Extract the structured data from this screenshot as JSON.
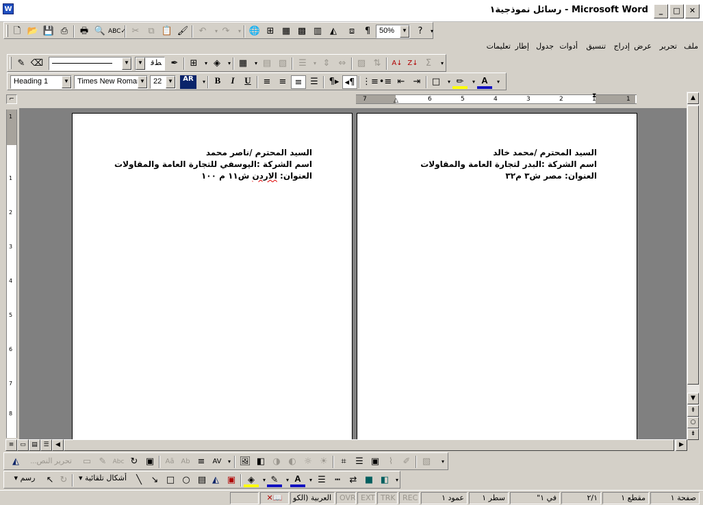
{
  "window": {
    "title": "رسائل نموذجية١ - Microsoft Word",
    "app_icon": "W",
    "buttons": [
      "_",
      "□",
      "✕"
    ]
  },
  "menu": {
    "items": [
      "ملف",
      "تحرير",
      "عرض",
      "إدراج",
      "تنسيق",
      "أدوات",
      "جدول",
      "إطار",
      "تعليمات"
    ]
  },
  "standard_toolbar": {
    "zoom": "50%"
  },
  "drawing_tools_toolbar": {
    "line_style": "",
    "direction_label": "ﻂﻗ"
  },
  "formatting_toolbar": {
    "style": "Heading 1",
    "font": "Times New Roman",
    "size": "22",
    "language_button": "AR",
    "bold": "B",
    "italic": "I",
    "underline": "U"
  },
  "ruler": {
    "h_numbers": [
      "7",
      "6",
      "5",
      "4",
      "3",
      "2",
      "1",
      "1"
    ],
    "v_numbers": [
      "1",
      "1",
      "2",
      "3",
      "4",
      "5",
      "6",
      "7",
      "8"
    ]
  },
  "pages": [
    {
      "lines": [
        {
          "text": "السيد المحترم /محمد خالد"
        },
        {
          "text": "اسم الشركة :البدر لتجارة العامة والمقاولات"
        },
        {
          "text": "العنوان: مصر ش٣ م٣٢"
        }
      ]
    },
    {
      "lines": [
        {
          "text": "السيد المحترم /ناصر محمد"
        },
        {
          "text": "اسم الشركة :اليوسفي للتجارة العامة والمقاولات"
        },
        {
          "text_before": "العنوان: ",
          "text_squiggle": "الاردن",
          "text_after": " ش١١ م ١٠٠"
        }
      ]
    }
  ],
  "reviewing_toolbar": {
    "edit_text": "تحرير النص..."
  },
  "drawing_toolbar": {
    "draw_label": "رسم",
    "autoshapes_label": "أشكال تلقائية"
  },
  "status_bar": {
    "page": "صفحة ١",
    "section": "مقطع ١",
    "page_of": "٢/١",
    "at": "في ١\"",
    "line": "سطر ١",
    "column": "عمود ١",
    "rec": "REC",
    "trk": "TRK",
    "ext": "EXT",
    "ovr": "OVR",
    "language": "العربية (الكو"
  },
  "colors": {
    "highlight": "#ffff00",
    "font_color": "#1010c0",
    "fill": "#ffff00"
  }
}
